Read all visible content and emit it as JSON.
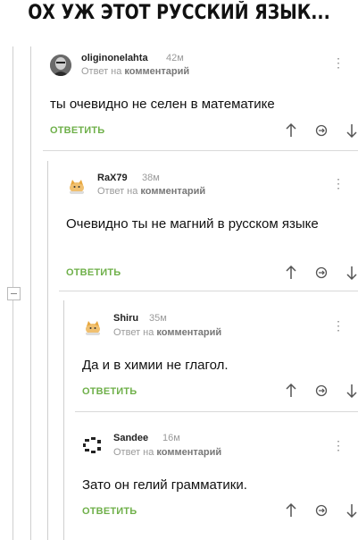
{
  "meme_title": "ОХ УЖ ЭТОТ РУССКИЙ ЯЗЫК...",
  "comments": [
    {
      "username": "oliginonelahta",
      "time": "42м",
      "reply_prefix": "Ответ на",
      "reply_target": "комментарий",
      "text": "ты очевидно не селен в математике",
      "reply_label": "ОТВЕТИТЬ",
      "avatar_icon": "portrait-icon"
    },
    {
      "username": "RaX79",
      "time": "38м",
      "reply_prefix": "Ответ на",
      "reply_target": "комментарий",
      "text": "Очевидно ты не магний в русском языке",
      "reply_label": "ОТВЕТИТЬ",
      "avatar_icon": "cat-icon"
    },
    {
      "username": "Shiru",
      "time": "35м",
      "reply_prefix": "Ответ на",
      "reply_target": "комментарий",
      "text": "Да и в химии не глагол.",
      "reply_label": "ОТВЕТИТЬ",
      "avatar_icon": "cat-icon"
    },
    {
      "username": "Sandee",
      "time": "16м",
      "reply_prefix": "Ответ на",
      "reply_target": "комментарий",
      "text": "Зато он гелий грамматики.",
      "reply_label": "ОТВЕТИТЬ",
      "avatar_icon": "ring-icon"
    }
  ],
  "colors": {
    "reply": "#6fb04a",
    "muted": "#9a9a9a",
    "thread_line": "#cfcfcf"
  },
  "icons": {
    "upvote": "arrow-up-icon",
    "repost": "repost-icon",
    "downvote": "arrow-down-icon",
    "more": "kebab-menu-icon",
    "collapse": "collapse-thread-icon"
  }
}
